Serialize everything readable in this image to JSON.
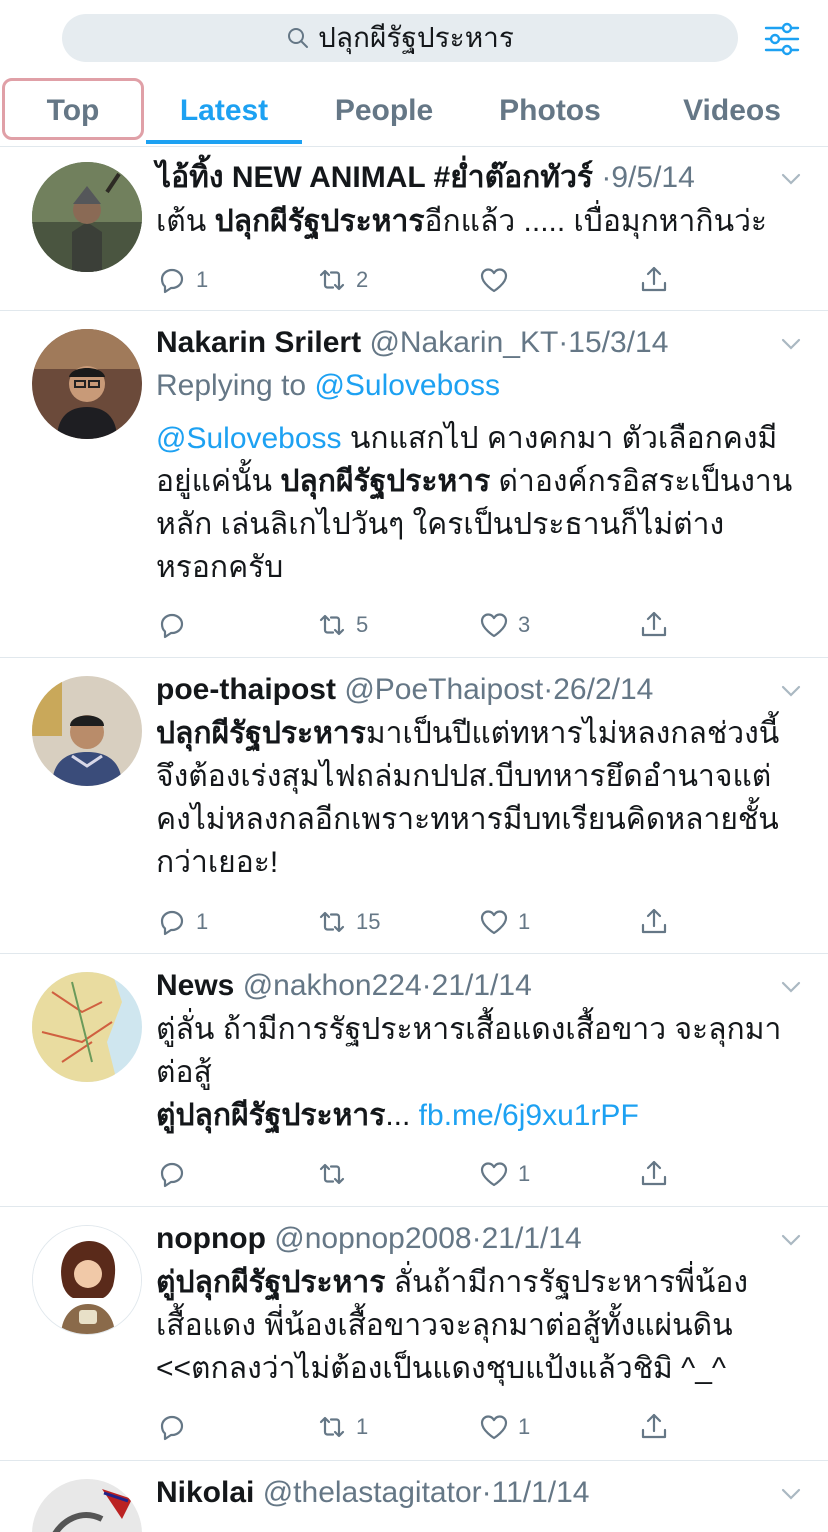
{
  "search": {
    "query": "ปลุกผีรัฐประหาร"
  },
  "tabs": [
    {
      "label": "Top"
    },
    {
      "label": "Latest"
    },
    {
      "label": "People"
    },
    {
      "label": "Photos"
    },
    {
      "label": "Videos"
    }
  ],
  "colors": {
    "accent": "#1da1f2",
    "secondary_text": "#657786",
    "divider": "#e1e8ed"
  },
  "tweets": [
    {
      "name": "ไอ้ทิ้ง NEW ANIMAL #ย่ำต๊อกทัวร์",
      "handle": "",
      "sep": "·",
      "date": "9/5/14",
      "body_parts": [
        "เต้น ",
        "ปลุกผีรัฐประหาร",
        "อีกแล้ว ..... เบื่อมุกหากินว่ะ"
      ],
      "reply_count": "1",
      "retweet_count": "2",
      "like_count": ""
    },
    {
      "name": "Nakarin Srilert",
      "handle": "@Nakarin_KT",
      "sep": "·",
      "date": "15/3/14",
      "replying_label": "Replying to ",
      "replying_handle": "@Suloveboss",
      "body_line1_mention": "@Suloveboss",
      "body_line1_rest": " นกแสกไป คางคกมา ตัวเลือกคงมี",
      "body_line2_a": "อยู่แค่นั้น ",
      "body_line2_bold": "ปลุกผีรัฐประหาร",
      "body_line2_b": " ด่าองค์กรอิสระเป็นงาน",
      "body_line3": "หลัก เล่นลิเกไปวันๆ ใครเป็นประธานก็ไม่ต่าง",
      "body_line4": "หรอกครับ",
      "reply_count": "",
      "retweet_count": "5",
      "like_count": "3"
    },
    {
      "name": "poe-thaipost",
      "handle": "@PoeThaipost",
      "sep": "·",
      "date": "26/2/14",
      "body_bold": "ปลุกผีรัฐประหาร",
      "body_line1_rest": "มาเป็นปีแต่ทหารไม่หลงกลช่วงนี้",
      "body_line2": "จึงต้องเร่งสุมไฟถล่มกปปส.บีบทหารยึดอำนาจแต่",
      "body_line3": "คงไม่หลงกลอีกเพราะทหารมีบทเรียนคิดหลายชั้น",
      "body_line4": "กว่าเยอะ!",
      "reply_count": "1",
      "retweet_count": "15",
      "like_count": "1"
    },
    {
      "name": "News",
      "handle": "@nakhon224",
      "sep": "·",
      "date": "21/1/14",
      "body_line1": "ตู่ลั่น ถ้ามีการรัฐประหารเสื้อแดงเสื้อขาว จะลุกมา",
      "body_line2": "ต่อสู้",
      "body_line3_a": "ตู่",
      "body_line3_bold": "ปลุกผีรัฐประหาร",
      "body_line3_b": "... ",
      "body_link": "fb.me/6j9xu1rPF",
      "reply_count": "",
      "retweet_count": "",
      "like_count": "1"
    },
    {
      "name": "nopnop",
      "handle": "@nopnop2008",
      "sep": "·",
      "date": "21/1/14",
      "body_line1_a": "ตู่",
      "body_line1_bold": "ปลุกผีรัฐประหาร",
      "body_line1_rest": " ลั่นถ้ามีการรัฐประหารพี่น้อง",
      "body_line2": "เสื้อแดง พี่น้องเสื้อขาวจะลุกมาต่อสู้ทั้งแผ่นดิน",
      "body_line3": "<<ตกลงว่าไม่ต้องเป็นแดงชุบแป้งแล้วชิมิ ^_^",
      "reply_count": "",
      "retweet_count": "1",
      "like_count": "1"
    },
    {
      "name": "Nikolai",
      "handle": "@thelastagitator",
      "sep": "·",
      "date": "11/1/14"
    }
  ]
}
